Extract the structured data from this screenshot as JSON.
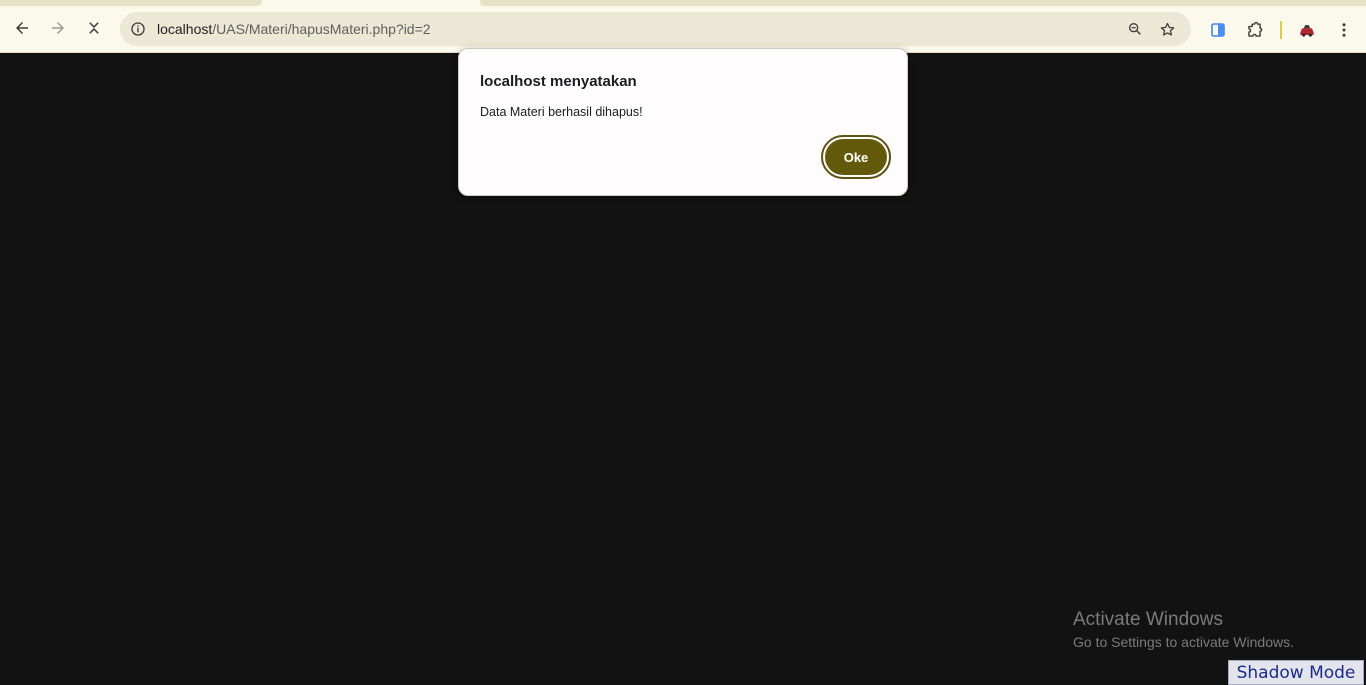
{
  "browser": {
    "url": {
      "host": "localhost",
      "path": "/UAS/Materi/hapusMateri.php?id=2"
    },
    "icons": {
      "back": "arrow-left-icon",
      "forward": "arrow-right-icon",
      "stop": "close-icon",
      "site_info": "info-icon",
      "zoom": "zoom-icon",
      "bookmark": "star-icon",
      "side_panel": "side-panel-icon",
      "extensions": "puzzle-icon",
      "profile": "profile-icon",
      "menu": "kebab-menu-icon"
    },
    "accent": "#625a0a"
  },
  "dialog": {
    "title": "localhost menyatakan",
    "message": "Data Materi berhasil dihapus!",
    "ok_label": "Oke"
  },
  "watermark": {
    "title": "Activate Windows",
    "subtitle": "Go to Settings to activate Windows."
  },
  "overlay": {
    "shadow_mode_label": "Shadow Mode"
  }
}
